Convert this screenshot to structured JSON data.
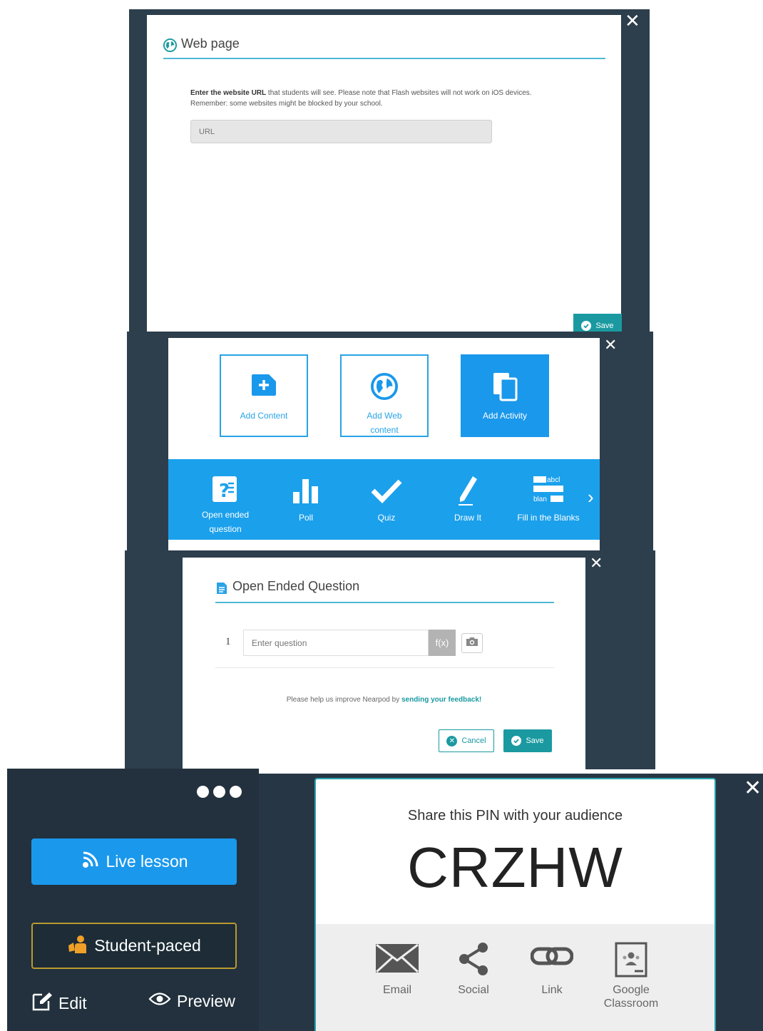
{
  "colors": {
    "dark_bg": "#2d3e4c",
    "accent_blue": "#1ba0ec",
    "teal": "#1a9aa0",
    "gold_border": "#b99a2f"
  },
  "web_page_dialog": {
    "title": "Web page",
    "title_icon": "globe-icon",
    "desc_bold": "Enter the website URL",
    "desc_line1_rest": " that students will see. Please note that Flash websites will not work on iOS devices.",
    "desc_line2": "Remember: some websites might be blocked by your school.",
    "url_placeholder": "URL",
    "save_label": "Save",
    "close_icon": "close-icon"
  },
  "add_dialog": {
    "cards": [
      {
        "label": "Add Content",
        "icon": "add-content-icon"
      },
      {
        "label_line1": "Add Web",
        "label_line2": "content",
        "icon": "globe-icon"
      },
      {
        "label": "Add Activity",
        "icon": "copy-icon"
      }
    ],
    "activities": [
      {
        "label_line1": "Open ended",
        "label_line2": "question",
        "icon": "open-ended-icon"
      },
      {
        "label": "Poll",
        "icon": "bar-chart-icon"
      },
      {
        "label": "Quiz",
        "icon": "checkmark-icon"
      },
      {
        "label": "Draw It",
        "icon": "pencil-icon"
      },
      {
        "label": "Fill in the Blanks",
        "icon": "fill-blanks-icon",
        "icon_text1": "abcl",
        "icon_text2": "blan"
      }
    ],
    "next_arrow": "›"
  },
  "open_ended_dialog": {
    "title": "Open Ended Question",
    "title_icon": "document-icon",
    "question_number": "1",
    "question_placeholder": "Enter question",
    "fx_label": "f(x)",
    "feedback_text": "Please help us improve Nearpod by ",
    "feedback_link": "sending your feedback!",
    "cancel_label": "Cancel",
    "save_label": "Save"
  },
  "lesson_menu": {
    "live_label": "Live lesson",
    "student_paced_label": "Student-paced",
    "edit_label": "Edit",
    "preview_label": "Preview"
  },
  "share_dialog": {
    "heading": "Share this PIN with your audience",
    "pin": "CRZHW",
    "options": [
      {
        "label": "Email",
        "icon": "envelope-icon"
      },
      {
        "label": "Social",
        "icon": "share-icon"
      },
      {
        "label": "Link",
        "icon": "link-icon"
      },
      {
        "label_line1": "Google",
        "label_line2": "Classroom",
        "icon": "google-classroom-icon"
      }
    ]
  }
}
